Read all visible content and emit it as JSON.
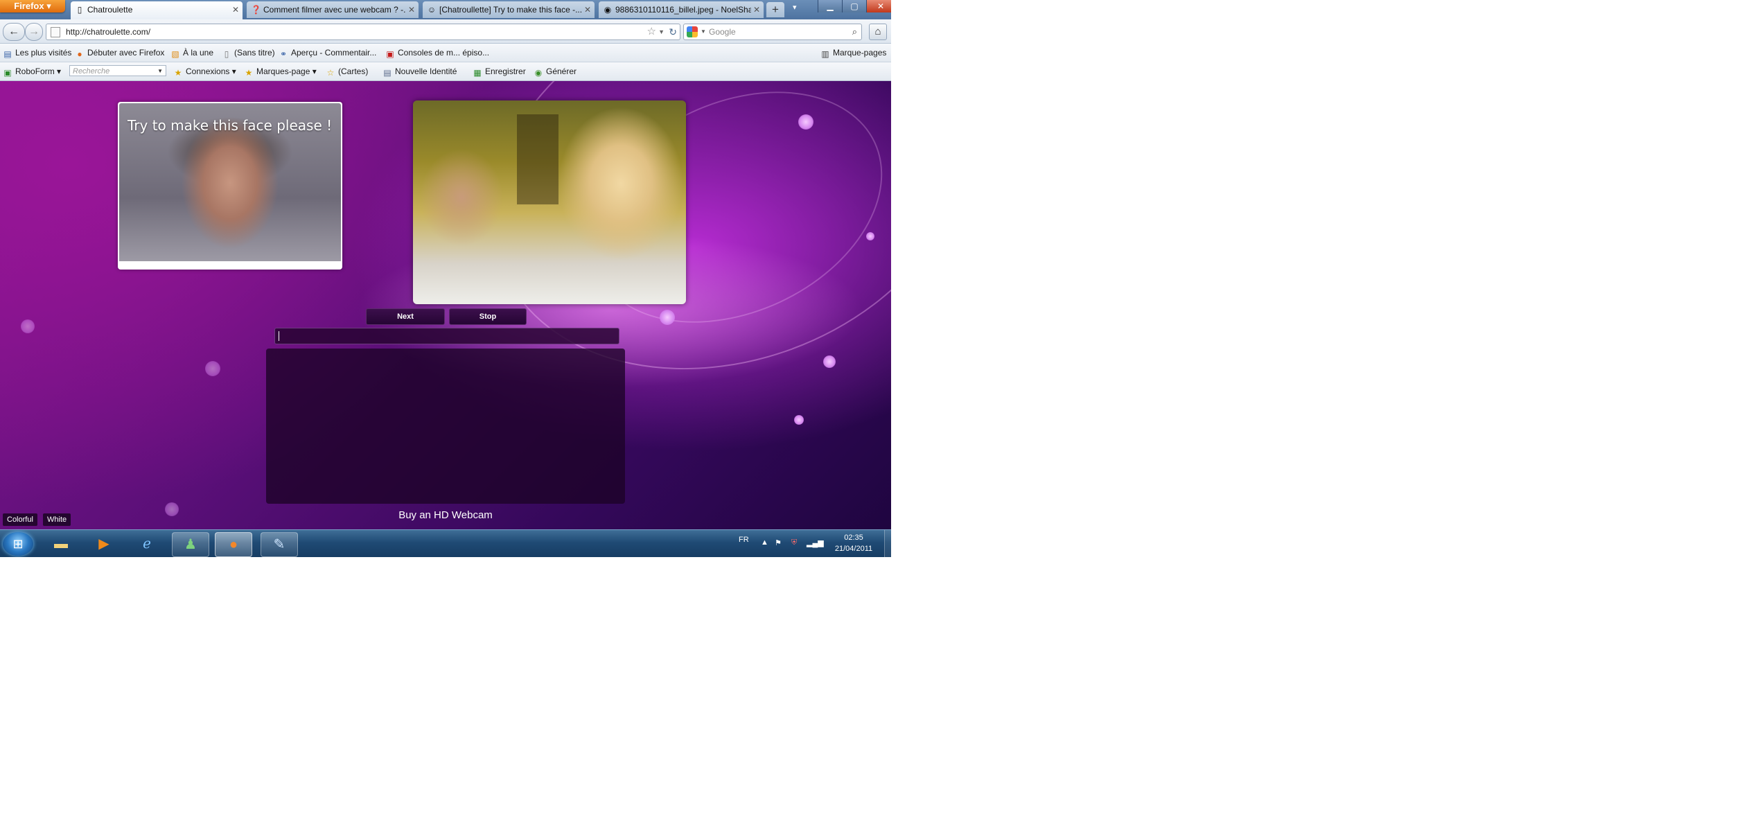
{
  "browser": {
    "menu_button": "Firefox",
    "tabs": [
      {
        "title": "Chatroulette",
        "favicon": "page-icon",
        "active": true
      },
      {
        "title": "Comment filmer avec une webcam ? -...",
        "favicon": "question-icon",
        "active": false
      },
      {
        "title": "[Chatroullette] Try to make this face -...",
        "favicon": "smiley-icon",
        "active": false
      },
      {
        "title": "9886310110116_billel.jpeg - NoelSha...",
        "favicon": "image-icon",
        "active": false
      }
    ],
    "new_tab": "+",
    "url": "http://chatroulette.com/",
    "search_placeholder": "Google"
  },
  "bookmarks": [
    {
      "label": "Les plus visités",
      "icon": "bookmark-icon"
    },
    {
      "label": "Débuter avec Firefox",
      "icon": "firefox-icon"
    },
    {
      "label": "À la une",
      "icon": "rss-icon"
    },
    {
      "label": "(Sans titre)",
      "icon": "page-icon"
    },
    {
      "label": "Aperçu - Commentair...",
      "icon": "link-icon"
    },
    {
      "label": "Consoles de m... épiso...",
      "icon": "youtube-icon"
    }
  ],
  "bookmarks_menu": "Marque-pages",
  "roboform": {
    "brand": "RoboForm",
    "search_placeholder": "Recherche",
    "items": [
      "Connexions",
      "Marques-page",
      "(Cartes)",
      "Nouvelle Identité",
      "Enregistrer",
      "Générer"
    ]
  },
  "page": {
    "caption": "Try to make this face please !",
    "next_button": "Next",
    "stop_button": "Stop",
    "buy_link": "Buy an HD Webcam",
    "theme_buttons": [
      "Colorful",
      "White"
    ]
  },
  "taskbar": {
    "language": "FR",
    "time": "02:35",
    "date": "21/04/2011"
  },
  "colors": {
    "accent_purple": "#8a1690",
    "dark_purple": "#250534",
    "taskbar_blue": "#1f4a74"
  }
}
